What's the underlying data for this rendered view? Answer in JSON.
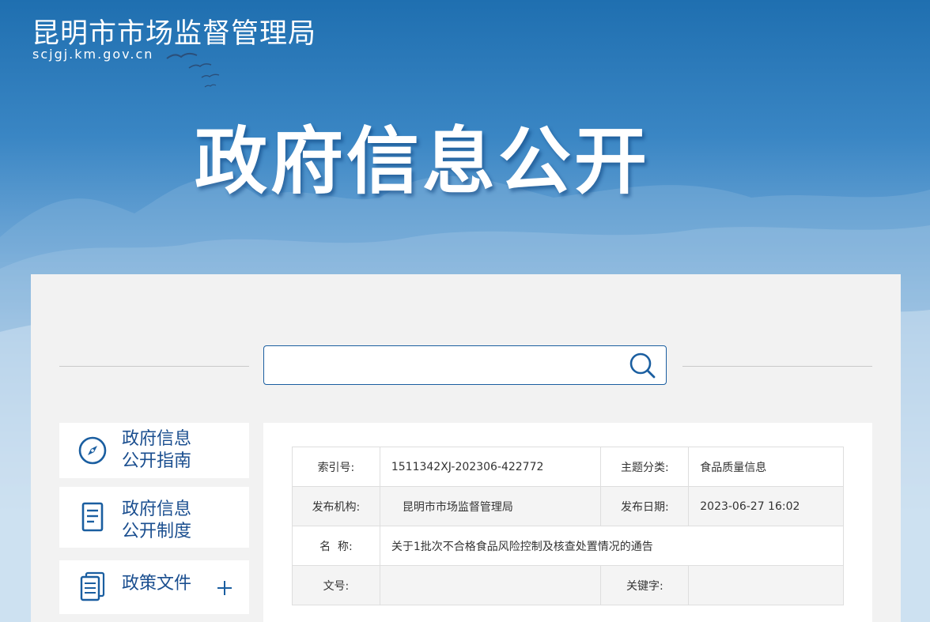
{
  "header": {
    "site_name": "昆明市市场监督管理局",
    "site_domain": "scjgj.km.gov.cn",
    "hero_title": "政府信息公开"
  },
  "search": {
    "value": "",
    "placeholder": ""
  },
  "sidebar": {
    "items": [
      {
        "line1": "政府信息",
        "line2": "公开指南",
        "icon": "compass-icon"
      },
      {
        "line1": "政府信息",
        "line2": "公开制度",
        "icon": "document-icon"
      },
      {
        "line1": "政策文件",
        "icon": "files-icon",
        "expand_icon": "plus-icon"
      }
    ]
  },
  "meta_table": {
    "index_no_label": "索引号:",
    "index_no_value": "1511342XJ-202306-422772",
    "category_label": "主题分类:",
    "category_value": "食品质量信息",
    "publisher_label": "发布机构:",
    "publisher_value": "昆明市市场监督管理局",
    "date_label": "发布日期:",
    "date_value": "2023-06-27 16:02",
    "title_label": "名  称:",
    "title_value": "关于1批次不合格食品风险控制及核查处置情况的通告",
    "doc_no_label": "文号:",
    "doc_no_value": "",
    "keywords_label": "关键字:",
    "keywords_value": ""
  },
  "colors": {
    "brand_blue": "#1a5ea0",
    "nav_text": "#1a4e8f",
    "panel_bg": "#f2f2f2"
  }
}
